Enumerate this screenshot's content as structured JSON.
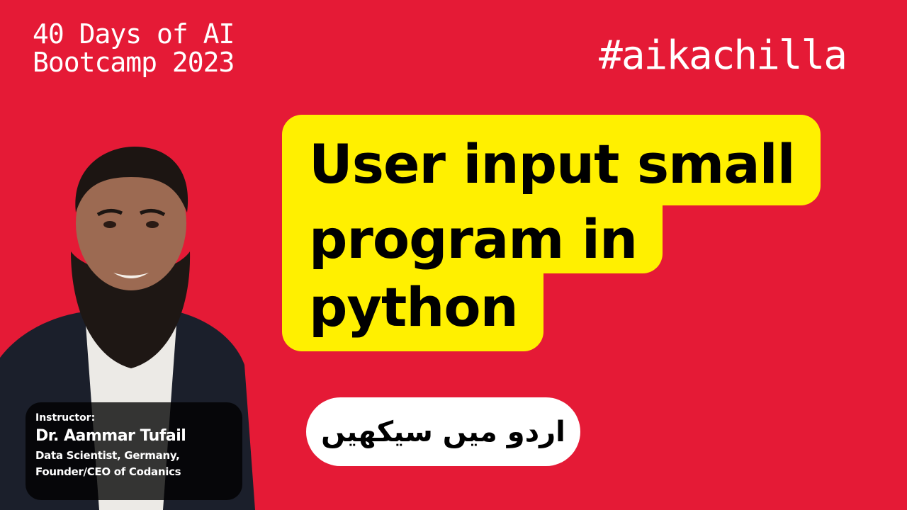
{
  "bootcamp": {
    "line1": "40 Days of AI",
    "line2": "Bootcamp 2023"
  },
  "hashtag": "#aikachilla",
  "title": {
    "line1": "User input small",
    "line2": "program in",
    "line3": "python"
  },
  "urdu_badge": "اردو میں سیکھیں",
  "instructor": {
    "label": "Instructor:",
    "name": "Dr. Aammar Tufail",
    "role_line1": "Data Scientist, Germany,",
    "role_line2": "Founder/CEO of Codanics"
  },
  "colors": {
    "background": "#e51a36",
    "title_highlight": "#fff000",
    "pill": "#ffffff",
    "card": "#000000"
  }
}
